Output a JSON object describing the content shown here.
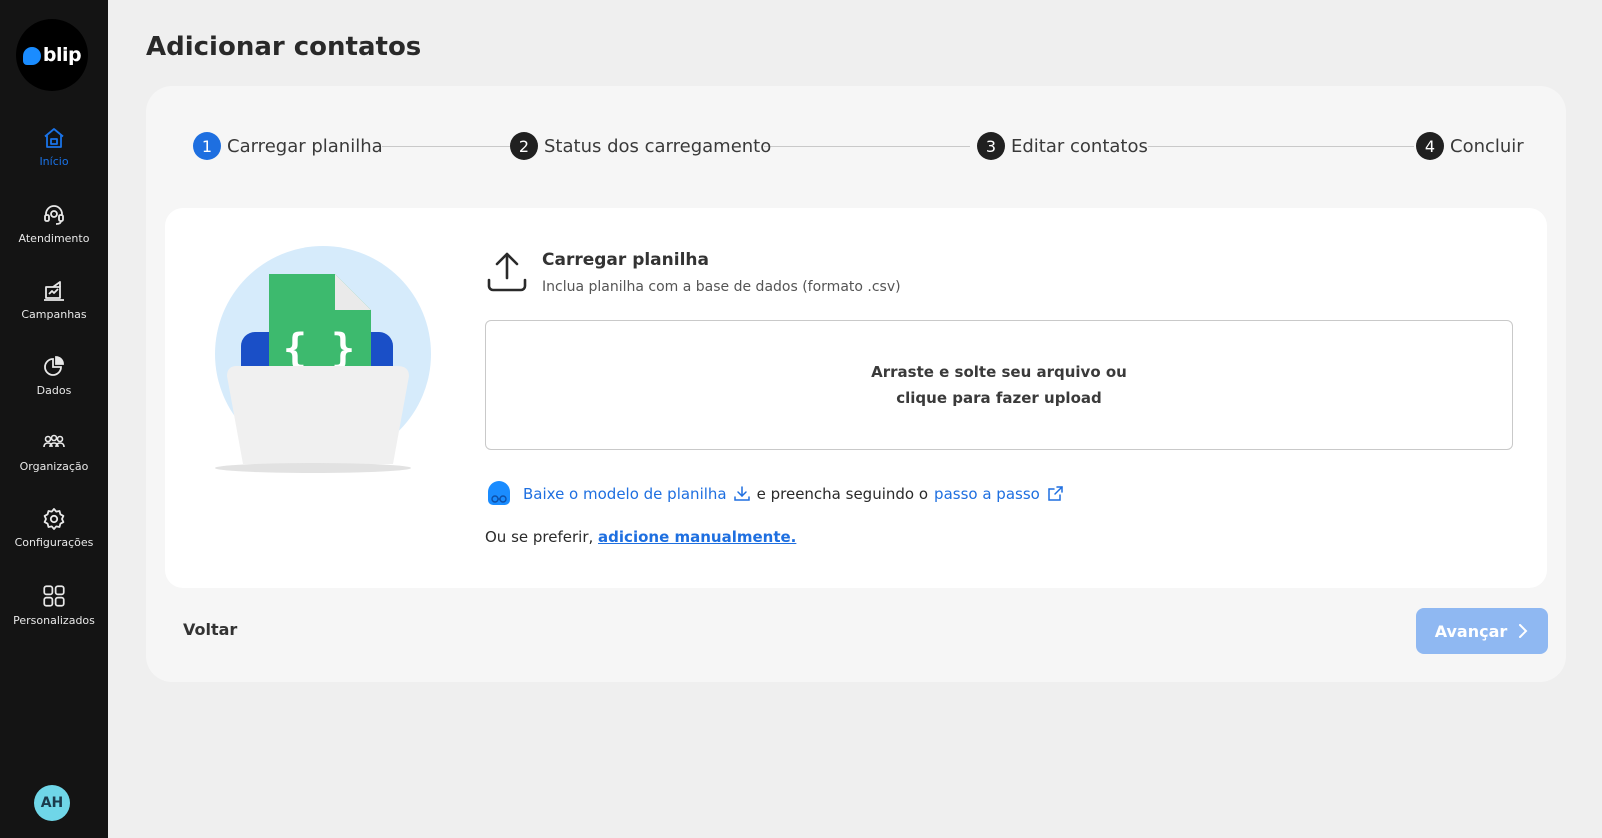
{
  "brand": {
    "logo_text": "blip"
  },
  "sidebar": {
    "items": [
      {
        "label": "Início",
        "icon": "home-icon",
        "active": true
      },
      {
        "label": "Atendimento",
        "icon": "headset-icon"
      },
      {
        "label": "Campanhas",
        "icon": "megaphone-icon"
      },
      {
        "label": "Dados",
        "icon": "pie-chart-icon"
      },
      {
        "label": "Organização",
        "icon": "team-icon"
      },
      {
        "label": "Configurações",
        "icon": "gear-icon"
      },
      {
        "label": "Personalizados",
        "icon": "grid-icon"
      }
    ],
    "avatar_initials": "AH"
  },
  "page": {
    "title": "Adicionar contatos"
  },
  "stepper": {
    "steps": [
      {
        "number": "1",
        "label": "Carregar planilha",
        "active": true
      },
      {
        "number": "2",
        "label": "Status dos carregamento"
      },
      {
        "number": "3",
        "label": "Editar contatos"
      },
      {
        "number": "4",
        "label": "Concluir"
      }
    ]
  },
  "upload": {
    "title": "Carregar planilha",
    "subtitle": "Inclua planilha com a base de dados (formato .csv)",
    "dropzone_line1": "Arraste e solte seu arquivo ou",
    "dropzone_line2": "clique para fazer upload",
    "illustration_glyph": "{ }"
  },
  "hint": {
    "download_link": "Baixe o modelo de planilha",
    "middle_text": "e preencha seguindo o",
    "guide_link": "passo a passo"
  },
  "manual": {
    "prefix": "Ou se preferir,",
    "link": "adicione manualmente."
  },
  "footer": {
    "back_label": "Voltar",
    "next_label": "Avançar"
  },
  "colors": {
    "accent": "#1e6fe0",
    "sidebar_bg": "#141414",
    "disabled_button": "#8fb8f2",
    "illustration_green": "#3dba6e",
    "illustration_blue": "#1a4fc7",
    "illustration_circle": "#d6ebfb"
  }
}
